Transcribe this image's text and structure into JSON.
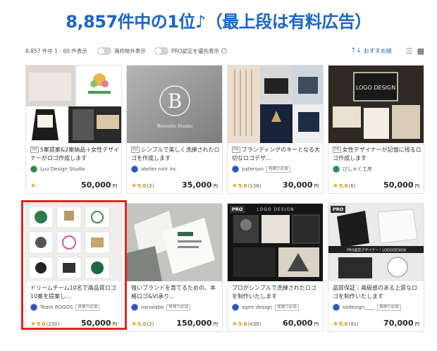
{
  "banner": {
    "text": "8,857件中の1位♪（最上段は有料広告）"
  },
  "toolbar": {
    "count": "8,857 件中 1 - 60 件表示",
    "toggle1_label": "満枠除外表示",
    "toggle2_label": "PRO認定を優先表示",
    "help": "?",
    "sort_label": "おすすめ順",
    "sort_icon": "↑↓",
    "list_view_icon": "☰",
    "grid_view_icon": "▦"
  },
  "cards": [
    {
      "pr": "PR",
      "pro": "",
      "title": "5案提案&2案納品＋女性デザイナーがロゴ作成します",
      "seller": "Luu Design Studio",
      "request": "",
      "score": "",
      "reviews": "-",
      "price": "50,000",
      "yen": "円"
    },
    {
      "pr": "PR",
      "pro": "",
      "title": "シンプルで美しく洗練されたロゴを作成します",
      "seller": "atelier noir inc",
      "request": "",
      "score": "5.0",
      "reviews": "(2)",
      "price": "35,000",
      "yen": "円",
      "thumb_text": "B",
      "thumb_sub": "Brocello Studio"
    },
    {
      "pr": "PR",
      "pro": "",
      "title": "ブランディングのキーとなる大切なロゴデザ...",
      "seller": "paterson",
      "request": "見積り必須",
      "score": "5.0",
      "reviews": "(138)",
      "price": "30,000",
      "yen": "円"
    },
    {
      "pr": "PR",
      "pro": "",
      "title": "女性デザイナーが記憶に残るロゴ作成します",
      "seller": "ぴしゃく工房",
      "request": "",
      "score": "5.0",
      "reviews": "(6)",
      "price": "50,000",
      "yen": "円",
      "thumb_text": "LOGO DESIGN"
    },
    {
      "pr": "",
      "pro": "",
      "title": "ドリームチーム10名で高品質ロゴ10案を提案し...",
      "seller": "Team ROGOS",
      "request": "見積り必須",
      "score": "5.0",
      "reviews": "(230)",
      "price": "50,000",
      "yen": "円"
    },
    {
      "pr": "",
      "pro": "",
      "title": "強いブランドを育てるための、本格ロゴ&VI承り...",
      "seller": "nanalabo",
      "request": "見積り必須",
      "score": "5.0",
      "reviews": "(2)",
      "price": "150,000",
      "yen": "円"
    },
    {
      "pr": "",
      "pro": "PRO",
      "title": "プロがシンプルで洗練されたロゴを制作いたします",
      "seller": "sgmr design",
      "request": "見積り必須",
      "score": "5.0",
      "reviews": "(439)",
      "price": "60,000",
      "yen": "円",
      "thumb_text": "LOGO DESIGN"
    },
    {
      "pr": "",
      "pro": "PRO",
      "title": "品質保証｜高級感のある上質なロゴを制作いたします",
      "seller": "sodesign____",
      "request": "見積り必須",
      "score": "5.0",
      "reviews": "(91)",
      "price": "70,000",
      "yen": "円",
      "thumb_text": "PRO認定デザイナー｜LOGODESIGN"
    }
  ],
  "colors": {
    "accent": "#1a66c9",
    "highlight": "#e3251e",
    "star": "#f1a20e"
  }
}
